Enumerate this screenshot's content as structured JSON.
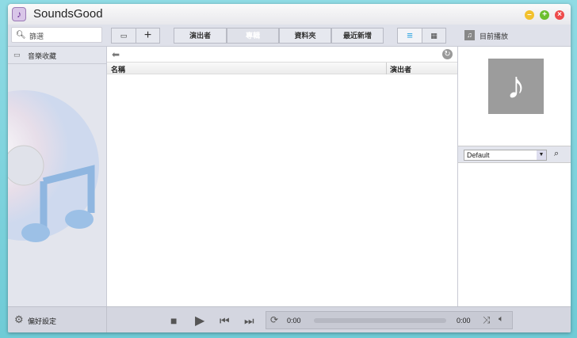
{
  "app": {
    "title": "SoundsGood"
  },
  "toolbar": {
    "search_placeholder": "篩選",
    "tabs": [
      {
        "label": "演出者",
        "selected": false
      },
      {
        "label": "專輯",
        "selected": true
      },
      {
        "label": "資料夾",
        "selected": false
      },
      {
        "label": "最近新增",
        "selected": false
      }
    ],
    "now_playing_label": "目前播放"
  },
  "sidebar": {
    "items": [
      {
        "label": "音樂收藏"
      }
    ],
    "preferences_label": "偏好設定"
  },
  "table": {
    "columns": [
      "名稱",
      "演出者"
    ]
  },
  "right": {
    "preset_value": "Default"
  },
  "player": {
    "elapsed": "0:00",
    "total": "0:00",
    "progress": 0
  },
  "colors": {
    "accent": "#29a3e0"
  }
}
